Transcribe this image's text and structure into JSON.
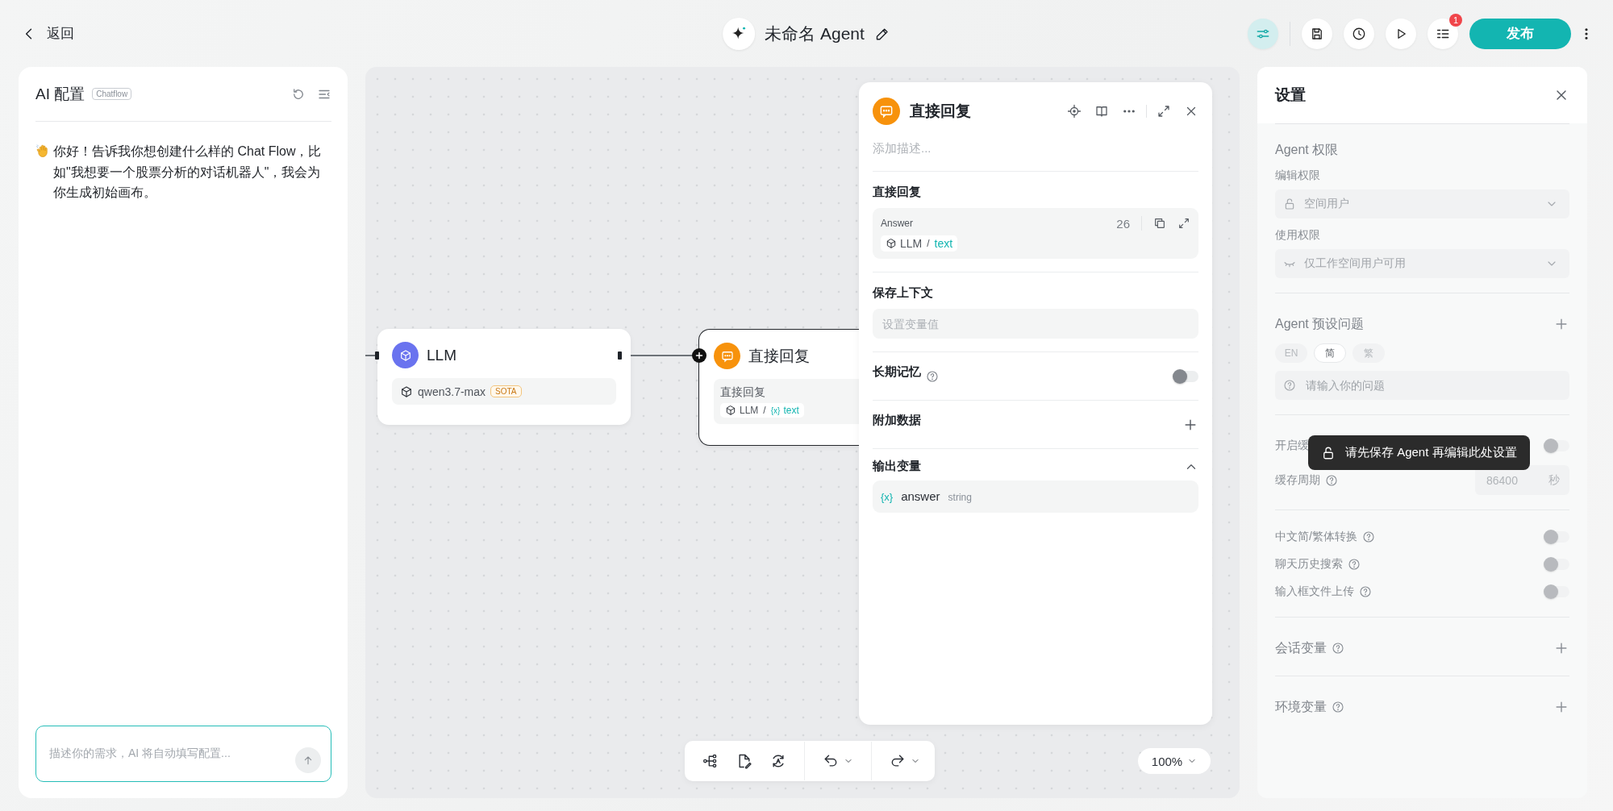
{
  "top_bar": {
    "back_label": "返回",
    "title": "未命名 Agent",
    "actions": [
      {
        "kind": "config",
        "selected": true
      },
      {
        "kind": "save",
        "selected": false
      },
      {
        "kind": "history",
        "selected": false
      },
      {
        "kind": "run",
        "selected": false
      },
      {
        "kind": "tasks",
        "selected": false,
        "badge": "1"
      }
    ],
    "publish_label": "发布"
  },
  "ai_panel": {
    "title": "AI 配置",
    "badge": "Chatflow",
    "message": "你好！告诉我你想创建什么样的 Chat Flow，比如\"我想要一个股票分析的对话机器人\"，我会为你生成初始画布。",
    "input": {
      "placeholder": "描述你的需求，AI 将自动填写配置..."
    }
  },
  "canvas": {
    "nodes": [
      {
        "kind": "llm",
        "title": "LLM",
        "model": "qwen3.7-max",
        "tag": "SOTA"
      },
      {
        "kind": "answer",
        "title": "直接回复",
        "body_label": "直接回复",
        "ref_node": "LLM",
        "separator": "/",
        "var_icon": "{x}",
        "ref_var": "text"
      }
    ],
    "zoom": "100%"
  },
  "detail_panel": {
    "title": "直接回复",
    "description_placeholder": "添加描述...",
    "answer_section": {
      "heading": "直接回复",
      "field_label": "Answer",
      "count": "26",
      "ref_node": "LLM",
      "separator": "/",
      "ref_var": "text"
    },
    "context_section": {
      "heading": "保存上下文",
      "placeholder": "设置变量值"
    },
    "memory": {
      "label": "长期记忆",
      "on": false
    },
    "extra_data": {
      "label": "附加数据"
    },
    "outputs": {
      "heading": "输出变量",
      "expanded": true,
      "items": [
        {
          "var_icon": "{x}",
          "name": "answer",
          "type": "string"
        }
      ]
    }
  },
  "settings": {
    "title": "设置",
    "permissions": {
      "heading": "Agent 权限",
      "fields": [
        {
          "label": "编辑权限",
          "kind": "lock",
          "value": "空间用户"
        },
        {
          "label": "使用权限",
          "kind": "eye",
          "value": "仅工作空间用户可用"
        }
      ]
    },
    "preset": {
      "heading": "Agent 预设问题",
      "languages": [
        {
          "label": "EN",
          "selected": false
        },
        {
          "label": "简",
          "selected": true
        },
        {
          "label": "繁",
          "selected": false
        }
      ],
      "placeholder": "请输入你的问题"
    },
    "cache": {
      "label": "开启缓",
      "on": false,
      "period_label": "缓存周期",
      "period_value": "86400",
      "period_unit": "秒"
    },
    "toggles": [
      {
        "label": "中文简/繁体转换",
        "on": false
      },
      {
        "label": "聊天历史搜索",
        "on": false
      },
      {
        "label": "输入框文件上传",
        "on": false
      }
    ],
    "variables": [
      {
        "label": "会话变量"
      },
      {
        "label": "环境变量"
      }
    ],
    "tooltip": "请先保存 Agent 再编辑此处设置"
  }
}
